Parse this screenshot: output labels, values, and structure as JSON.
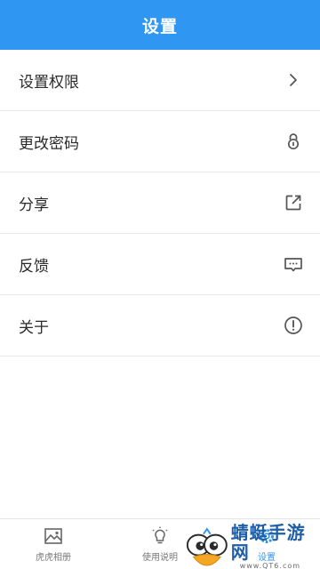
{
  "header": {
    "title": "设置"
  },
  "menu": {
    "items": [
      {
        "label": "设置权限",
        "icon": "chevron-right-icon"
      },
      {
        "label": "更改密码",
        "icon": "lock-icon"
      },
      {
        "label": "分享",
        "icon": "share-icon"
      },
      {
        "label": "反馈",
        "icon": "feedback-icon"
      },
      {
        "label": "关于",
        "icon": "info-icon"
      }
    ]
  },
  "tabbar": {
    "tabs": [
      {
        "label": "虎虎相册",
        "icon": "image-icon"
      },
      {
        "label": "使用说明",
        "icon": "lightbulb-icon"
      },
      {
        "label": "设置",
        "icon": "gear-icon",
        "active": true
      }
    ]
  },
  "watermark": {
    "title": "蜻蜓手游网",
    "url": "www.QT6.com"
  },
  "colors": {
    "accent": "#2f96f2",
    "text": "#2a2a2a",
    "divider": "#e9e9e9",
    "tab_inactive": "#777777"
  }
}
